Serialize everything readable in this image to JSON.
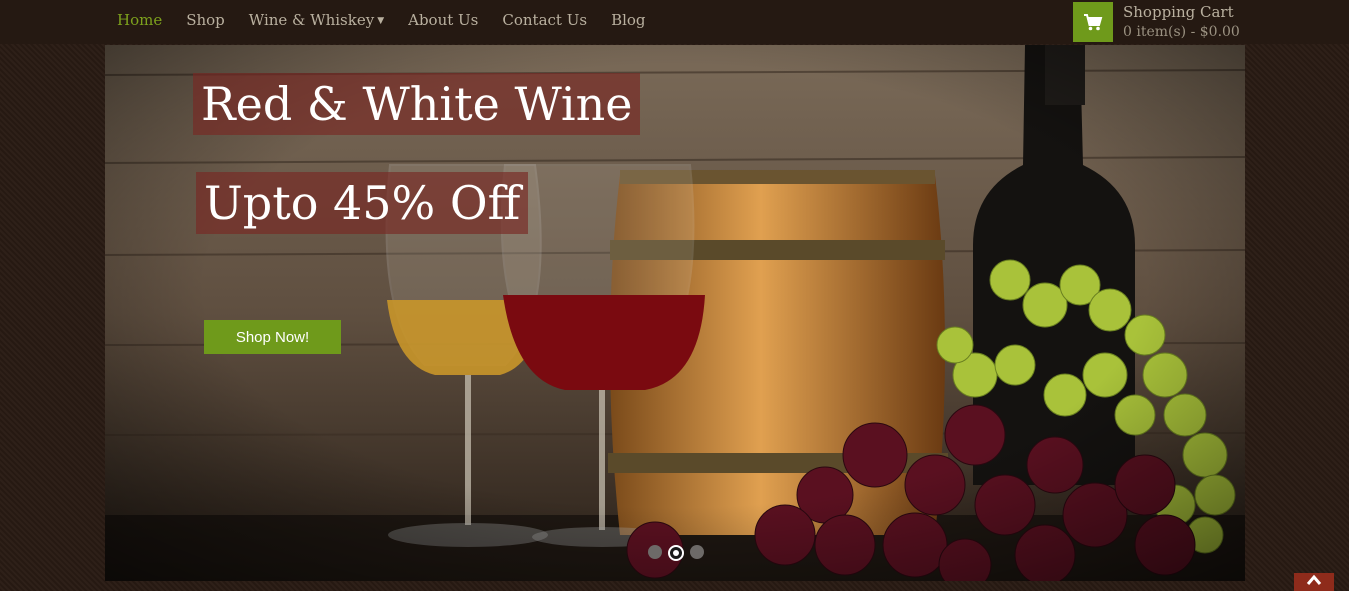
{
  "nav": {
    "items": [
      {
        "label": "Home"
      },
      {
        "label": "Shop"
      },
      {
        "label": "Wine & Whiskey"
      },
      {
        "label": "About Us"
      },
      {
        "label": "Contact Us"
      },
      {
        "label": "Blog"
      }
    ],
    "active_item": "Home",
    "dropdown_icon": "caret-down-icon"
  },
  "cart": {
    "title": "Shopping Cart",
    "summary": "0 item(s) - $0.00",
    "icon": "shopping-cart-icon"
  },
  "slider": {
    "headline": "Red & White Wine",
    "subheadline": "Upto 45% Off",
    "button_label": "Shop Now!",
    "dots": [
      {
        "active": false
      },
      {
        "active": true
      },
      {
        "active": false
      }
    ]
  },
  "colors": {
    "accent": "#6f9a1b",
    "nav_active": "#7da11d",
    "background": "#2a1c14",
    "scroll_top": "#8e2b1b"
  }
}
